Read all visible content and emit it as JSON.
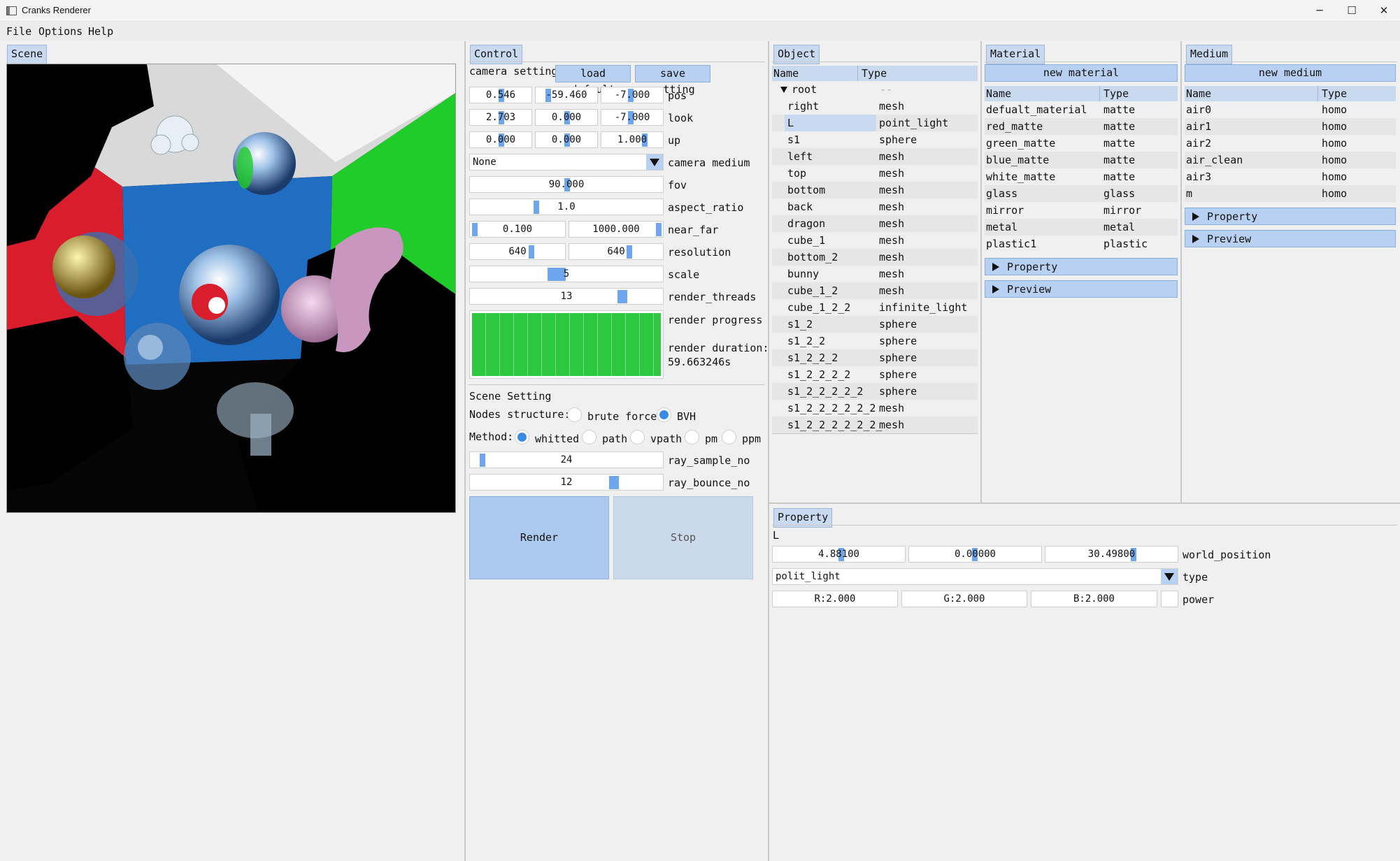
{
  "window": {
    "title": "Cranks Renderer",
    "minimize": "─",
    "maximize": "☐",
    "close": "✕"
  },
  "menubar": [
    "File",
    "Options",
    "Help"
  ],
  "scene": {
    "tab": "Scene"
  },
  "control": {
    "tab": "Control",
    "camera_setting": "camera setting",
    "load_default": "load default",
    "save_setting": "save setting",
    "pos": {
      "label": "pos",
      "values": [
        "0.546",
        "-59.460",
        "-7.000"
      ]
    },
    "look": {
      "label": "look",
      "values": [
        "2.703",
        "0.000",
        "-7.000"
      ]
    },
    "up": {
      "label": "up",
      "values": [
        "0.000",
        "0.000",
        "1.000"
      ]
    },
    "camera_medium": {
      "label": "camera medium",
      "value": "None"
    },
    "fov": {
      "label": "fov",
      "value": "90.000"
    },
    "aspect_ratio": {
      "label": "aspect_ratio",
      "value": "1.0"
    },
    "near_far": {
      "label": "near_far",
      "values": [
        "0.100",
        "1000.000"
      ]
    },
    "resolution": {
      "label": "resolution",
      "values": [
        "640",
        "640"
      ]
    },
    "scale": {
      "label": "scale",
      "value": "5"
    },
    "render_threads": {
      "label": "render_threads",
      "value": "13"
    },
    "render_progress": {
      "label": "render progress",
      "fraction": 1.0,
      "color": "#2ec840"
    },
    "render_duration": {
      "label": "render duration:",
      "value": "59.663246s"
    },
    "scene_setting": "Scene Setting",
    "nodes_structure": {
      "label": "Nodes structure:",
      "options": [
        "brute force",
        "BVH"
      ],
      "selected": "BVH"
    },
    "method": {
      "label": "Method:",
      "options": [
        "whitted",
        "path",
        "vpath",
        "pm",
        "ppm"
      ],
      "selected": "whitted"
    },
    "ray_sample_no": {
      "label": "ray_sample_no",
      "value": "24"
    },
    "ray_bounce_no": {
      "label": "ray_bounce_no",
      "value": "12"
    },
    "render_button": "Render",
    "stop_button": "Stop"
  },
  "object": {
    "tab": "Object",
    "columns": [
      "Name",
      "Type"
    ],
    "root": {
      "name": "root",
      "type": "--"
    },
    "rows": [
      {
        "name": "right",
        "type": "mesh"
      },
      {
        "name": "L",
        "type": "point_light",
        "selected": true
      },
      {
        "name": "s1",
        "type": "sphere"
      },
      {
        "name": "left",
        "type": "mesh"
      },
      {
        "name": "top",
        "type": "mesh"
      },
      {
        "name": "bottom",
        "type": "mesh"
      },
      {
        "name": "back",
        "type": "mesh"
      },
      {
        "name": "dragon",
        "type": "mesh"
      },
      {
        "name": "cube_1",
        "type": "mesh"
      },
      {
        "name": "bottom_2",
        "type": "mesh"
      },
      {
        "name": "bunny",
        "type": "mesh"
      },
      {
        "name": "cube_1_2",
        "type": "mesh"
      },
      {
        "name": "cube_1_2_2",
        "type": "infinite_light"
      },
      {
        "name": "s1_2",
        "type": "sphere"
      },
      {
        "name": "s1_2_2",
        "type": "sphere"
      },
      {
        "name": "s1_2_2_2",
        "type": "sphere"
      },
      {
        "name": "s1_2_2_2_2",
        "type": "sphere"
      },
      {
        "name": "s1_2_2_2_2_2",
        "type": "sphere"
      },
      {
        "name": "s1_2_2_2_2_2_2",
        "type": "mesh"
      },
      {
        "name": "s1_2_2_2_2_2_2_",
        "type": "mesh"
      }
    ]
  },
  "material": {
    "tab": "Material",
    "new_button": "new material",
    "columns": [
      "Name",
      "Type"
    ],
    "rows": [
      {
        "name": "defualt_material",
        "type": "matte"
      },
      {
        "name": "red_matte",
        "type": "matte"
      },
      {
        "name": "green_matte",
        "type": "matte"
      },
      {
        "name": "blue_matte",
        "type": "matte"
      },
      {
        "name": "white_matte",
        "type": "matte"
      },
      {
        "name": "glass",
        "type": "glass"
      },
      {
        "name": "mirror",
        "type": "mirror"
      },
      {
        "name": "metal",
        "type": "metal"
      },
      {
        "name": "plastic1",
        "type": "plastic"
      }
    ],
    "property": "Property",
    "preview": "Preview"
  },
  "medium": {
    "tab": "Medium",
    "new_button": "new medium",
    "columns": [
      "Name",
      "Type"
    ],
    "rows": [
      {
        "name": "air0",
        "type": "homo"
      },
      {
        "name": "air1",
        "type": "homo"
      },
      {
        "name": "air2",
        "type": "homo"
      },
      {
        "name": "air_clean",
        "type": "homo"
      },
      {
        "name": "air3",
        "type": "homo"
      },
      {
        "name": "m",
        "type": "homo"
      }
    ],
    "property": "Property",
    "preview": "Preview"
  },
  "property": {
    "tab": "Property",
    "object_name": "L",
    "world_position": {
      "label": "world_position",
      "values": [
        "4.88100",
        "0.00000",
        "30.49800"
      ]
    },
    "type": {
      "label": "type",
      "value": "polit_light"
    },
    "power": {
      "label": "power",
      "values": [
        "R:2.000",
        "G:2.000",
        "B:2.000"
      ]
    }
  }
}
